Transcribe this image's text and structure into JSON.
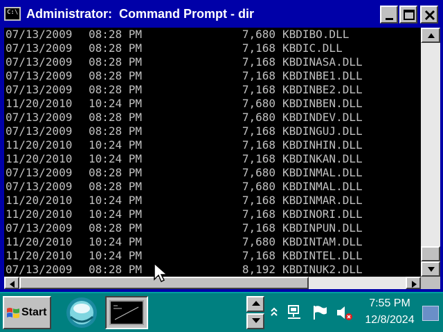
{
  "window": {
    "title": "Administrator:  Command Prompt - dir",
    "icon": "console-icon"
  },
  "console": {
    "rows": [
      {
        "date": "07/13/2009",
        "time": "08:28 PM",
        "size": "7,680",
        "name": "KBDIBO.DLL"
      },
      {
        "date": "07/13/2009",
        "time": "08:28 PM",
        "size": "7,168",
        "name": "KBDIC.DLL"
      },
      {
        "date": "07/13/2009",
        "time": "08:28 PM",
        "size": "7,168",
        "name": "KBDINASA.DLL"
      },
      {
        "date": "07/13/2009",
        "time": "08:28 PM",
        "size": "7,168",
        "name": "KBDINBE1.DLL"
      },
      {
        "date": "07/13/2009",
        "time": "08:28 PM",
        "size": "7,168",
        "name": "KBDINBE2.DLL"
      },
      {
        "date": "11/20/2010",
        "time": "10:24 PM",
        "size": "7,680",
        "name": "KBDINBEN.DLL"
      },
      {
        "date": "07/13/2009",
        "time": "08:28 PM",
        "size": "7,680",
        "name": "KBDINDEV.DLL"
      },
      {
        "date": "07/13/2009",
        "time": "08:28 PM",
        "size": "7,168",
        "name": "KBDINGUJ.DLL"
      },
      {
        "date": "11/20/2010",
        "time": "10:24 PM",
        "size": "7,168",
        "name": "KBDINHIN.DLL"
      },
      {
        "date": "11/20/2010",
        "time": "10:24 PM",
        "size": "7,168",
        "name": "KBDINKAN.DLL"
      },
      {
        "date": "07/13/2009",
        "time": "08:28 PM",
        "size": "7,680",
        "name": "KBDINMAL.DLL"
      },
      {
        "date": "07/13/2009",
        "time": "08:28 PM",
        "size": "7,680",
        "name": "KBDINMAL.DLL"
      },
      {
        "date": "11/20/2010",
        "time": "10:24 PM",
        "size": "7,168",
        "name": "KBDINMAR.DLL"
      },
      {
        "date": "11/20/2010",
        "time": "10:24 PM",
        "size": "7,168",
        "name": "KBDINORI.DLL"
      },
      {
        "date": "07/13/2009",
        "time": "08:28 PM",
        "size": "7,168",
        "name": "KBDINPUN.DLL"
      },
      {
        "date": "11/20/2010",
        "time": "10:24 PM",
        "size": "7,680",
        "name": "KBDINTAM.DLL"
      },
      {
        "date": "11/20/2010",
        "time": "10:24 PM",
        "size": "7,168",
        "name": "KBDINTEL.DLL"
      },
      {
        "date": "07/13/2009",
        "time": "08:28 PM",
        "size": "8,192",
        "name": "KBDINUK2.DLL"
      }
    ]
  },
  "taskbar": {
    "start_label": "Start",
    "tasks": [
      {
        "icon": "orb-app-icon"
      },
      {
        "icon": "command-prompt-thumbnail-icon",
        "active": true
      }
    ],
    "tray_icons": [
      "chevron-up-icon",
      "network-icon",
      "flag-icon",
      "speaker-muted-icon"
    ],
    "clock_time": "7:55 PM",
    "clock_date": "12/8/2024"
  },
  "colors": {
    "titlebar": "#0000a8",
    "console_bg": "#000000",
    "console_text": "#c0c0c0",
    "desktop": "#008080",
    "chrome": "#c0c0c0"
  }
}
